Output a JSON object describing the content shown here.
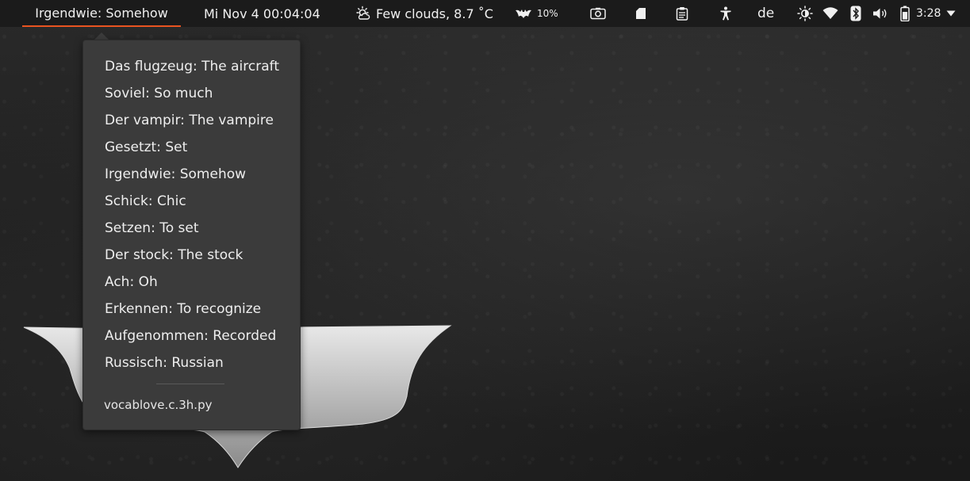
{
  "panel": {
    "active_indicator_label": "Irgendwie: Somehow",
    "clock": "Mi Nov 4  00:04:04",
    "weather": {
      "icon": "partly-cloudy-sun-icon",
      "text": "Few clouds, 8.7 ˚C"
    },
    "batsys": {
      "icon": "bat-icon",
      "text": "10%"
    },
    "icons": [
      "screenshot-icon",
      "files-icon",
      "clipboard-icon",
      "accessibility-icon",
      "language-de",
      "brightness-icon",
      "wifi-icon",
      "bluetooth-icon",
      "volume-icon"
    ],
    "language": "de",
    "battery_time": "3:28",
    "accent_color": "#e95420"
  },
  "menu": {
    "items": [
      "Das flugzeug: The aircraft",
      "Soviel: So much",
      "Der vampir: The vampire",
      "Gesetzt: Set",
      "Irgendwie: Somehow",
      "Schick: Chic",
      "Setzen: To set",
      "Der stock: The stock",
      "Ach: Oh",
      "Erkennen: To recognize",
      "Aufgenommen: Recorded",
      "Russisch: Russian"
    ],
    "footer": "vocablove.c.3h.py"
  }
}
